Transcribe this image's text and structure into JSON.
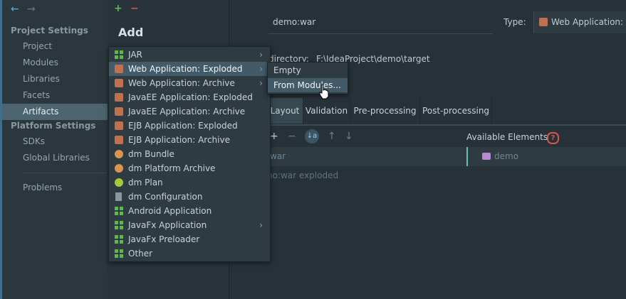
{
  "sidebar": {
    "back_glyph": "←",
    "forward_glyph": "→",
    "sections": [
      {
        "title": "Project Settings",
        "items": [
          "Project",
          "Modules",
          "Libraries",
          "Facets",
          "Artifacts"
        ]
      },
      {
        "title": "Platform Settings",
        "items": [
          "SDKs",
          "Global Libraries"
        ]
      }
    ],
    "extra_item": "Problems",
    "selected": "Artifacts"
  },
  "toolbar": {
    "add_glyph": "+",
    "remove_glyph": "−"
  },
  "add_popup": {
    "title": "Add",
    "items": [
      {
        "label": "JAR",
        "icon": "jar-icon",
        "submenu": true
      },
      {
        "label": "Web Application: Exploded",
        "icon": "web-app-icon",
        "submenu": true,
        "highlighted": true
      },
      {
        "label": "Web Application: Archive",
        "icon": "web-archive-icon",
        "submenu": true
      },
      {
        "label": "JavaEE Application: Exploded",
        "icon": "javaee-icon",
        "submenu": false
      },
      {
        "label": "JavaEE Application: Archive",
        "icon": "javaee-archive-icon",
        "submenu": false
      },
      {
        "label": "EJB Application: Exploded",
        "icon": "ejb-icon",
        "submenu": false
      },
      {
        "label": "EJB Application: Archive",
        "icon": "ejb-archive-icon",
        "submenu": false
      },
      {
        "label": "dm Bundle",
        "icon": "dm-bundle-icon",
        "submenu": false
      },
      {
        "label": "dm Platform Archive",
        "icon": "dm-archive-icon",
        "submenu": false
      },
      {
        "label": "dm Plan",
        "icon": "dm-plan-icon",
        "submenu": false
      },
      {
        "label": "dm Configuration",
        "icon": "dm-config-icon",
        "submenu": false
      },
      {
        "label": "Android Application",
        "icon": "android-icon",
        "submenu": false
      },
      {
        "label": "JavaFx Application",
        "icon": "javafx-icon",
        "submenu": true
      },
      {
        "label": "JavaFx Preloader",
        "icon": "javafx-preloader-icon",
        "submenu": false
      },
      {
        "label": "Other",
        "icon": "other-icon",
        "submenu": false
      }
    ]
  },
  "submenu": {
    "items": [
      "Empty",
      "From Modules..."
    ],
    "highlighted": "From Modules..."
  },
  "artifact": {
    "name_value": "demo:war",
    "type_label": "Type:",
    "type_value": "Web Application: A",
    "output_dir_label": "directory:",
    "output_dir_value": "F:\\IdeaProject\\demo\\target"
  },
  "tabs": [
    "Layout",
    "Validation",
    "Pre-processing",
    "Post-processing"
  ],
  "selected_tab": "Layout",
  "layout": {
    "available_elements_label": "Available Elements",
    "help_glyph": "?",
    "tree_root": "war",
    "tree_child": "no:war exploded",
    "available_item": "demo"
  },
  "colors": {
    "accent": "#4b6470",
    "highlight": "#435b68",
    "green": "#5fb84f",
    "red": "#d9534f"
  }
}
